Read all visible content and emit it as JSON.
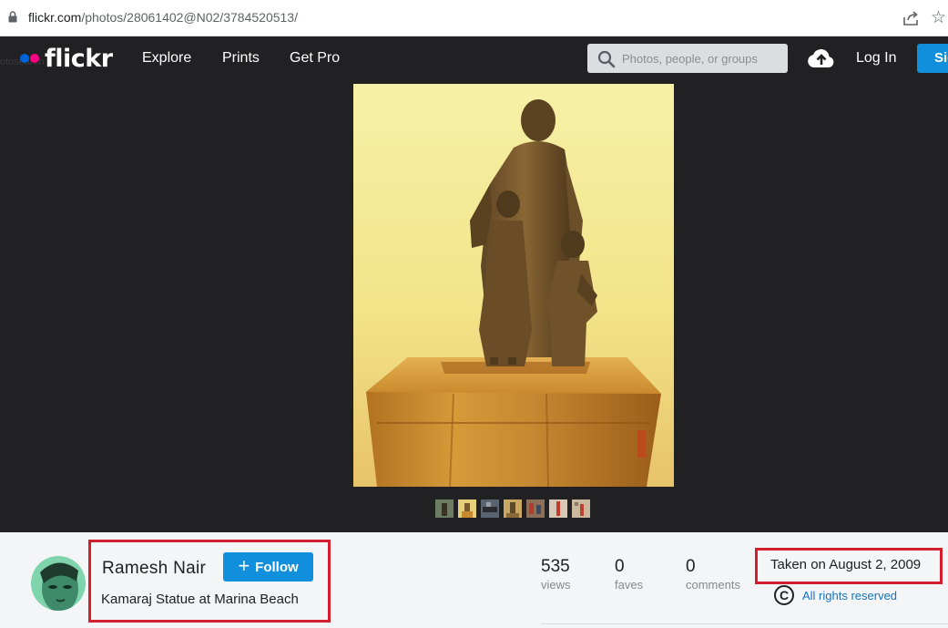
{
  "browser": {
    "url_domain": "flickr.com",
    "url_path": "/photos/28061402@N02/3784520513/"
  },
  "nav": {
    "logo": "flickr",
    "ghost_text": "otosearch",
    "links": [
      "Explore",
      "Prints",
      "Get Pro"
    ],
    "search_placeholder": "Photos, people, or groups",
    "login": "Log In",
    "signup": "Sign Up"
  },
  "photo": {
    "thumbnail_count": 7
  },
  "owner": {
    "name": "Ramesh Nair",
    "follow_label": "Follow",
    "photo_title": "Kamaraj Statue at Marina Beach"
  },
  "stats": [
    {
      "value": "535",
      "label": "views"
    },
    {
      "value": "0",
      "label": "faves"
    },
    {
      "value": "0",
      "label": "comments"
    }
  ],
  "meta": {
    "taken": "Taken on August 2, 2009",
    "copyright_symbol": "C",
    "rights": "All rights reserved"
  },
  "colors": {
    "accent": "#128fdc",
    "highlight": "#d21f2d",
    "link": "#1473c3",
    "nav_bg": "#212124"
  },
  "icons": [
    "lock-icon",
    "share-icon",
    "bookmark-star-icon",
    "search-icon",
    "upload-cloud-icon",
    "copyright-icon",
    "plus-icon"
  ]
}
